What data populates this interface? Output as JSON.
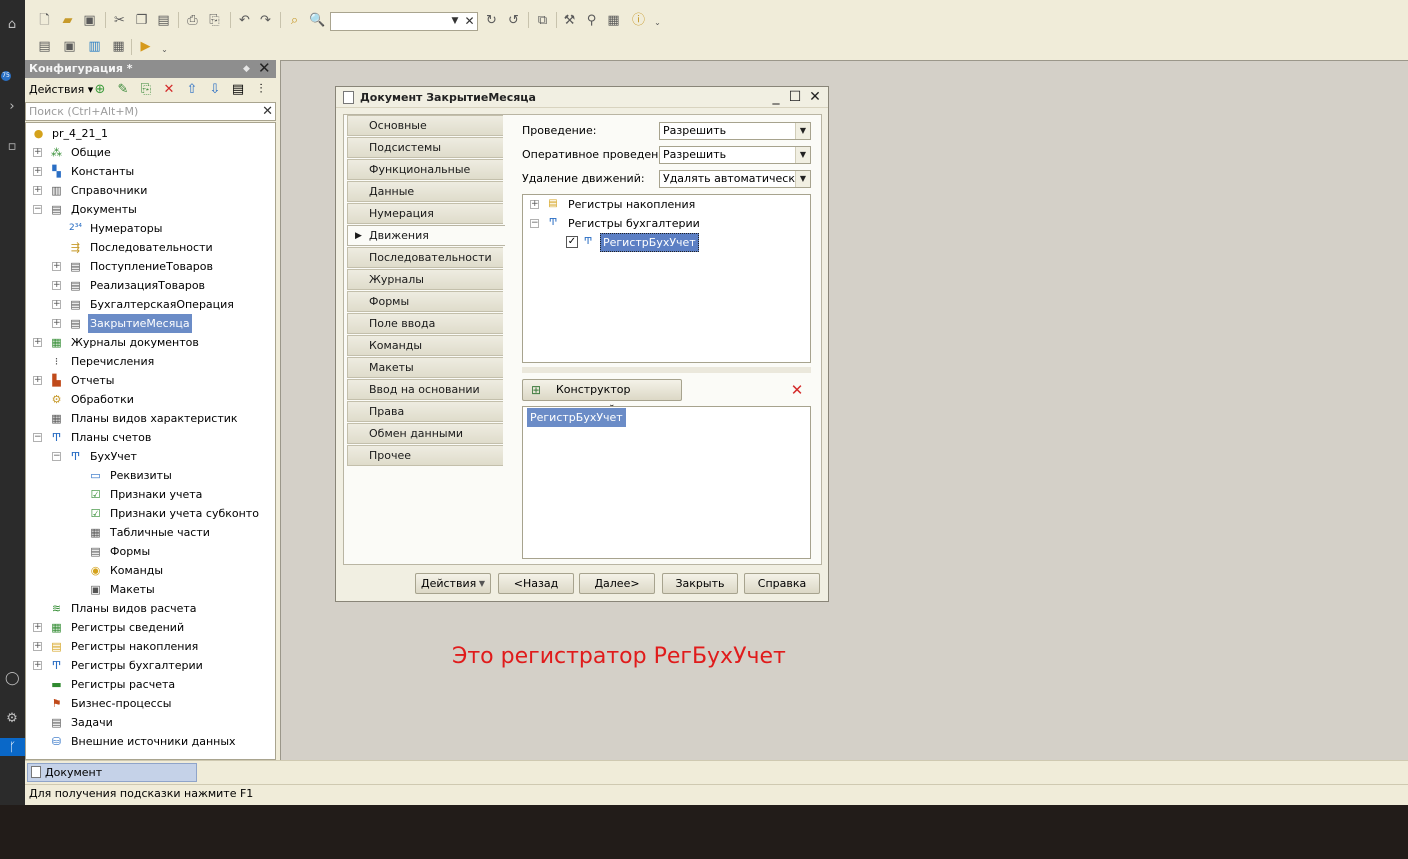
{
  "configuration_panel": {
    "title": "Конфигурация *",
    "actions_label": "Действия",
    "search_placeholder": "Поиск (Ctrl+Alt+M)",
    "tree": [
      {
        "label": "pr_4_21_1"
      },
      {
        "label": "Общие"
      },
      {
        "label": "Константы"
      },
      {
        "label": "Справочники"
      },
      {
        "label": "Документы"
      },
      {
        "label": "Нумераторы"
      },
      {
        "label": "Последовательности"
      },
      {
        "label": "ПоступлениеТоваров"
      },
      {
        "label": "РеализацияТоваров"
      },
      {
        "label": "БухгалтерскаяОперация"
      },
      {
        "label": "ЗакрытиеМесяца"
      },
      {
        "label": "Журналы документов"
      },
      {
        "label": "Перечисления"
      },
      {
        "label": "Отчеты"
      },
      {
        "label": "Обработки"
      },
      {
        "label": "Планы видов характеристик"
      },
      {
        "label": "Планы счетов"
      },
      {
        "label": "БухУчет"
      },
      {
        "label": "Реквизиты"
      },
      {
        "label": "Признаки учета"
      },
      {
        "label": "Признаки учета субконто"
      },
      {
        "label": "Табличные части"
      },
      {
        "label": "Формы"
      },
      {
        "label": "Команды"
      },
      {
        "label": "Макеты"
      },
      {
        "label": "Планы видов расчета"
      },
      {
        "label": "Регистры сведений"
      },
      {
        "label": "Регистры накопления"
      },
      {
        "label": "Регистры бухгалтерии"
      },
      {
        "label": "Регистры расчета"
      },
      {
        "label": "Бизнес-процессы"
      },
      {
        "label": "Задачи"
      },
      {
        "label": "Внешние источники данных"
      }
    ]
  },
  "document_window": {
    "title": "Документ ЗакрытиеМесяца",
    "tabs": [
      {
        "label": "Основные"
      },
      {
        "label": "Подсистемы"
      },
      {
        "label": "Функциональные опции"
      },
      {
        "label": "Данные"
      },
      {
        "label": "Нумерация"
      },
      {
        "label": "Движения"
      },
      {
        "label": "Последовательности"
      },
      {
        "label": "Журналы"
      },
      {
        "label": "Формы"
      },
      {
        "label": "Поле ввода"
      },
      {
        "label": "Команды"
      },
      {
        "label": "Макеты"
      },
      {
        "label": "Ввод на основании"
      },
      {
        "label": "Права"
      },
      {
        "label": "Обмен данными"
      },
      {
        "label": "Прочее"
      }
    ],
    "active_tab": "Движения",
    "fields": {
      "posting_label": "Проведение:",
      "posting_value": "Разрешить",
      "realtime_label": "Оперативное проведение:",
      "realtime_value": "Разрешить",
      "delete_label": "Удаление движений:",
      "delete_value": "Удалять автоматически п"
    },
    "register_tree": {
      "accum": "Регистры накопления",
      "accounting": "Регистры бухгалтерии",
      "selected": "РегистрБухУчет"
    },
    "constructor_button": "Конструктор движений",
    "movements_list": [
      "РегистрБухУчет"
    ],
    "buttons": {
      "actions": "Действия",
      "back": "<Назад",
      "next": "Далее>",
      "close": "Закрыть",
      "help": "Справка"
    }
  },
  "taskbar": {
    "open_window": "Документ ЗакрытиеМесяца"
  },
  "status_bar": "Для получения подсказки нажмите F1",
  "annotation": "Это регистратор РегБухУчет"
}
